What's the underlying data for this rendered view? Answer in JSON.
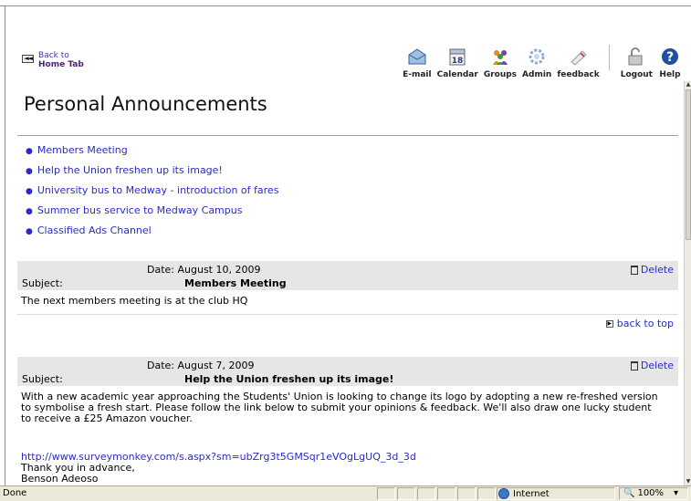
{
  "header": {
    "back_line1": "Back to",
    "back_line2": "Home Tab",
    "back_arrow": "◄◄",
    "tools": [
      {
        "label": "E-mail",
        "icon": "mail-icon"
      },
      {
        "label": "Calendar",
        "icon": "calendar-icon",
        "day": "18"
      },
      {
        "label": "Groups",
        "icon": "groups-icon"
      },
      {
        "label": "Admin",
        "icon": "admin-icon"
      },
      {
        "label": "feedback",
        "icon": "feedback-icon"
      },
      {
        "label": "Logout",
        "icon": "logout-icon"
      },
      {
        "label": "Help",
        "icon": "help-icon",
        "glyph": "?"
      }
    ]
  },
  "page": {
    "title": "Personal Announcements",
    "links": [
      "Members Meeting",
      "Help the Union freshen up its image!",
      "University bus to Medway - introduction of fares",
      "Summer bus service to Medway Campus",
      "Classified Ads Channel"
    ],
    "announcements": [
      {
        "date": "Date:  August 10, 2009",
        "subject_label": "Subject:",
        "subject": "Members Meeting",
        "delete": "Delete",
        "body": "The next members meeting is at the club HQ",
        "back_to_top": "back to top"
      },
      {
        "date": "Date:  August 7, 2009",
        "subject_label": "Subject:",
        "subject": "Help the Union freshen up its image!",
        "delete": "Delete",
        "body": "With a new academic year approaching the Students' Union is looking to change its logo by adopting a new re-freshed version to symbolise a fresh start. Please follow the link below to submit your opinions & feedback. We'll also draw one lucky student to receive a £25 Amazon voucher.",
        "url": "http://www.surveymonkey.com/s.aspx?sm=ubZrg3t5GMSqr1eVOgLgUQ_3d_3d",
        "sign1": "Thank you in advance,",
        "sign2": "Benson Adeoso"
      }
    ]
  },
  "statusbar": {
    "status": "Done",
    "zone": "Internet",
    "zoom": "100%"
  },
  "colors": {
    "link": "#2a2acc",
    "header_band": "#e6e6e6",
    "statusbar": "#ece9d8"
  }
}
